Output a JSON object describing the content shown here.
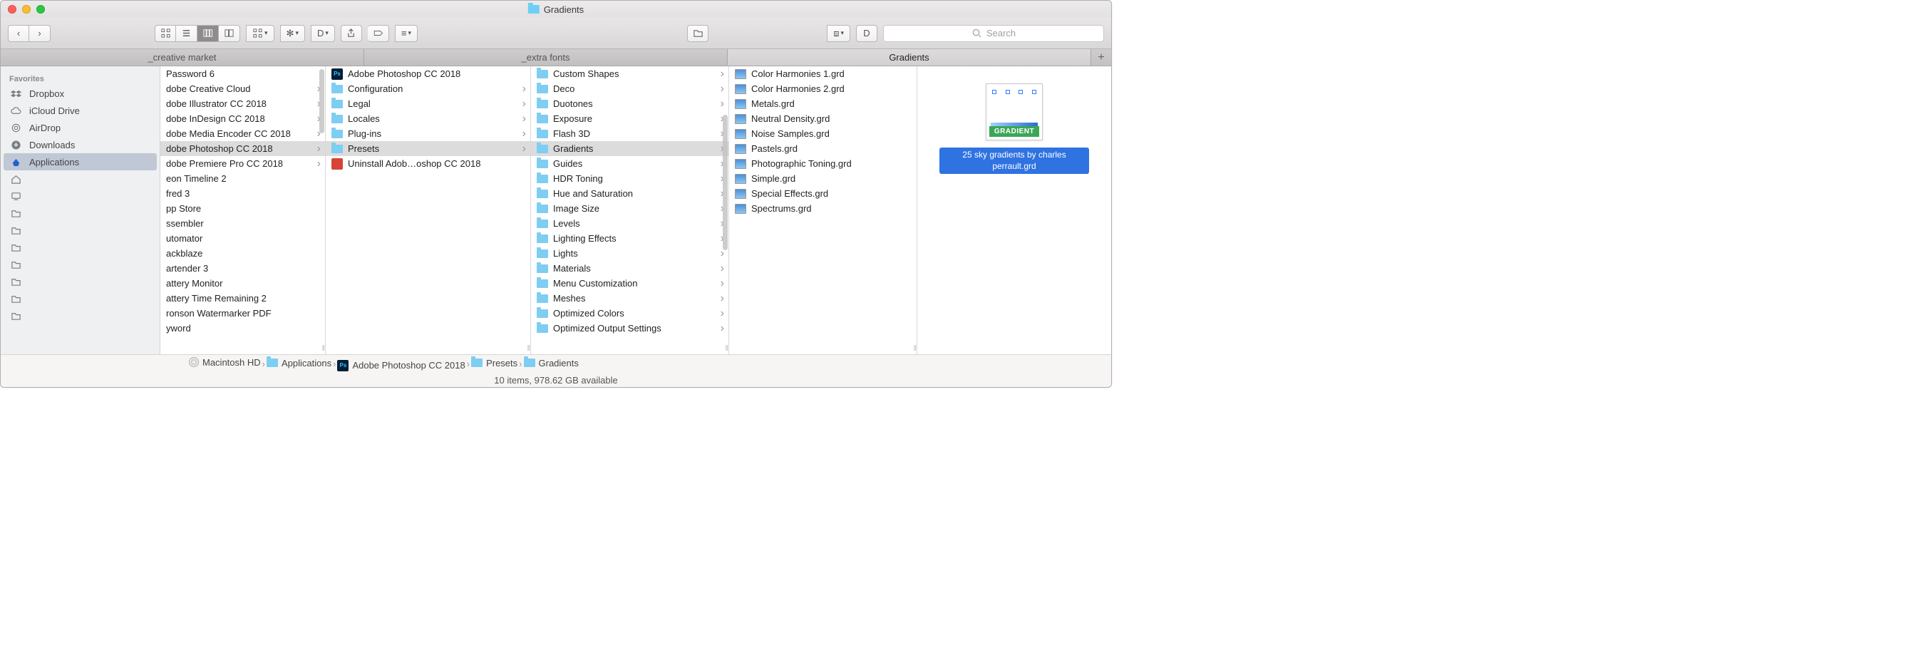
{
  "window": {
    "title": "Gradients"
  },
  "search": {
    "placeholder": "Search"
  },
  "tabs": {
    "items": [
      {
        "label": "_creative market"
      },
      {
        "label": "_extra fonts"
      },
      {
        "label": "Gradients"
      }
    ]
  },
  "sidebar": {
    "heading": "Favorites",
    "items": [
      {
        "label": "Dropbox",
        "icon": "dropbox"
      },
      {
        "label": "iCloud Drive",
        "icon": "cloud"
      },
      {
        "label": "AirDrop",
        "icon": "airdrop"
      },
      {
        "label": "Downloads",
        "icon": "download"
      },
      {
        "label": "Applications",
        "icon": "apps",
        "selected": true
      },
      {
        "label": "",
        "icon": "home"
      },
      {
        "label": "",
        "icon": "desktop"
      },
      {
        "label": "",
        "icon": "folder"
      },
      {
        "label": "",
        "icon": "folder"
      },
      {
        "label": "",
        "icon": "folder"
      },
      {
        "label": "",
        "icon": "folder"
      },
      {
        "label": "",
        "icon": "folder"
      },
      {
        "label": "",
        "icon": "folder"
      },
      {
        "label": "",
        "icon": "folder"
      }
    ]
  },
  "columns": {
    "col0": [
      {
        "label": "Password 6"
      },
      {
        "label": "dobe Creative Cloud",
        "dir": true
      },
      {
        "label": "dobe Illustrator CC 2018",
        "dir": true
      },
      {
        "label": "dobe InDesign CC 2018",
        "dir": true
      },
      {
        "label": "dobe Media Encoder CC 2018",
        "dir": true
      },
      {
        "label": "dobe Photoshop CC 2018",
        "dir": true,
        "selected": true
      },
      {
        "label": "dobe Premiere Pro CC 2018",
        "dir": true
      },
      {
        "label": "eon Timeline 2"
      },
      {
        "label": "fred 3"
      },
      {
        "label": "pp Store"
      },
      {
        "label": "ssembler"
      },
      {
        "label": "utomator"
      },
      {
        "label": "ackblaze"
      },
      {
        "label": "artender 3"
      },
      {
        "label": "attery Monitor"
      },
      {
        "label": "attery Time Remaining 2"
      },
      {
        "label": "ronson Watermarker PDF"
      },
      {
        "label": "yword"
      }
    ],
    "col1": [
      {
        "label": "Adobe Photoshop CC 2018",
        "icon": "ps"
      },
      {
        "label": "Configuration",
        "icon": "folder",
        "dir": true
      },
      {
        "label": "Legal",
        "icon": "folder",
        "dir": true
      },
      {
        "label": "Locales",
        "icon": "folder",
        "dir": true
      },
      {
        "label": "Plug-ins",
        "icon": "folder",
        "dir": true
      },
      {
        "label": "Presets",
        "icon": "folder",
        "dir": true,
        "selected": true
      },
      {
        "label": "Uninstall Adob…oshop CC 2018",
        "icon": "red"
      }
    ],
    "col2": [
      {
        "label": "Custom Shapes",
        "dir": true
      },
      {
        "label": "Deco",
        "dir": true
      },
      {
        "label": "Duotones",
        "dir": true
      },
      {
        "label": "Exposure",
        "dir": true
      },
      {
        "label": "Flash 3D",
        "dir": true
      },
      {
        "label": "Gradients",
        "dir": true,
        "selected": true
      },
      {
        "label": "Guides",
        "dir": true
      },
      {
        "label": "HDR Toning",
        "dir": true
      },
      {
        "label": "Hue and Saturation",
        "dir": true
      },
      {
        "label": "Image Size",
        "dir": true
      },
      {
        "label": "Levels",
        "dir": true
      },
      {
        "label": "Lighting Effects",
        "dir": true
      },
      {
        "label": "Lights",
        "dir": true
      },
      {
        "label": "Materials",
        "dir": true
      },
      {
        "label": "Menu Customization",
        "dir": true
      },
      {
        "label": "Meshes",
        "dir": true
      },
      {
        "label": "Optimized Colors",
        "dir": true
      },
      {
        "label": "Optimized Output Settings",
        "dir": true
      }
    ],
    "col3": [
      {
        "label": "Color Harmonies 1.grd"
      },
      {
        "label": "Color Harmonies 2.grd"
      },
      {
        "label": "Metals.grd"
      },
      {
        "label": "Neutral Density.grd"
      },
      {
        "label": "Noise Samples.grd"
      },
      {
        "label": "Pastels.grd"
      },
      {
        "label": "Photographic Toning.grd"
      },
      {
        "label": "Simple.grd"
      },
      {
        "label": "Special Effects.grd"
      },
      {
        "label": "Spectrums.grd"
      }
    ]
  },
  "preview": {
    "badge": "GRADIENT",
    "filename": "25 sky gradients by charles perrault.grd"
  },
  "pathbar": {
    "items": [
      {
        "label": "Macintosh HD",
        "icon": "disk"
      },
      {
        "label": "Applications",
        "icon": "folder"
      },
      {
        "label": "Adobe Photoshop CC 2018",
        "icon": "ps"
      },
      {
        "label": "Presets",
        "icon": "folder"
      },
      {
        "label": "Gradients",
        "icon": "folder"
      }
    ]
  },
  "status": {
    "text": "10 items, 978.62 GB available"
  }
}
